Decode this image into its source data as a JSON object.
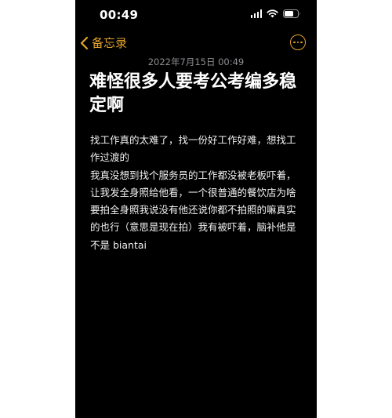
{
  "status_bar": {
    "time": "00:49",
    "icons": [
      "signal-icon",
      "wifi-icon",
      "battery-icon"
    ]
  },
  "nav": {
    "back_label": "备忘录",
    "back_icon": "chevron-left-icon",
    "more_icon": "ellipsis-circle-icon",
    "accent_color": "#e3a52c"
  },
  "note": {
    "date": "2022年7月15日 00:49",
    "title": "难怪很多人要考公考编多稳定啊",
    "paragraphs": [
      " 找工作真的太难了，找一份好工作好难，想找工作过渡的",
      " 我真没想到找个服务员的工作都没被老板吓着，让我发全身照给他看，一个很普通的餐饮店为啥要拍全身照我说没有他还说你都不拍照的嘛真实的也行（意思是现在拍）我有被吓着，脑补他是不是 biantai"
    ]
  },
  "colors": {
    "background": "#000000",
    "text": "#ffffff",
    "secondary_text": "#8e8e93"
  }
}
